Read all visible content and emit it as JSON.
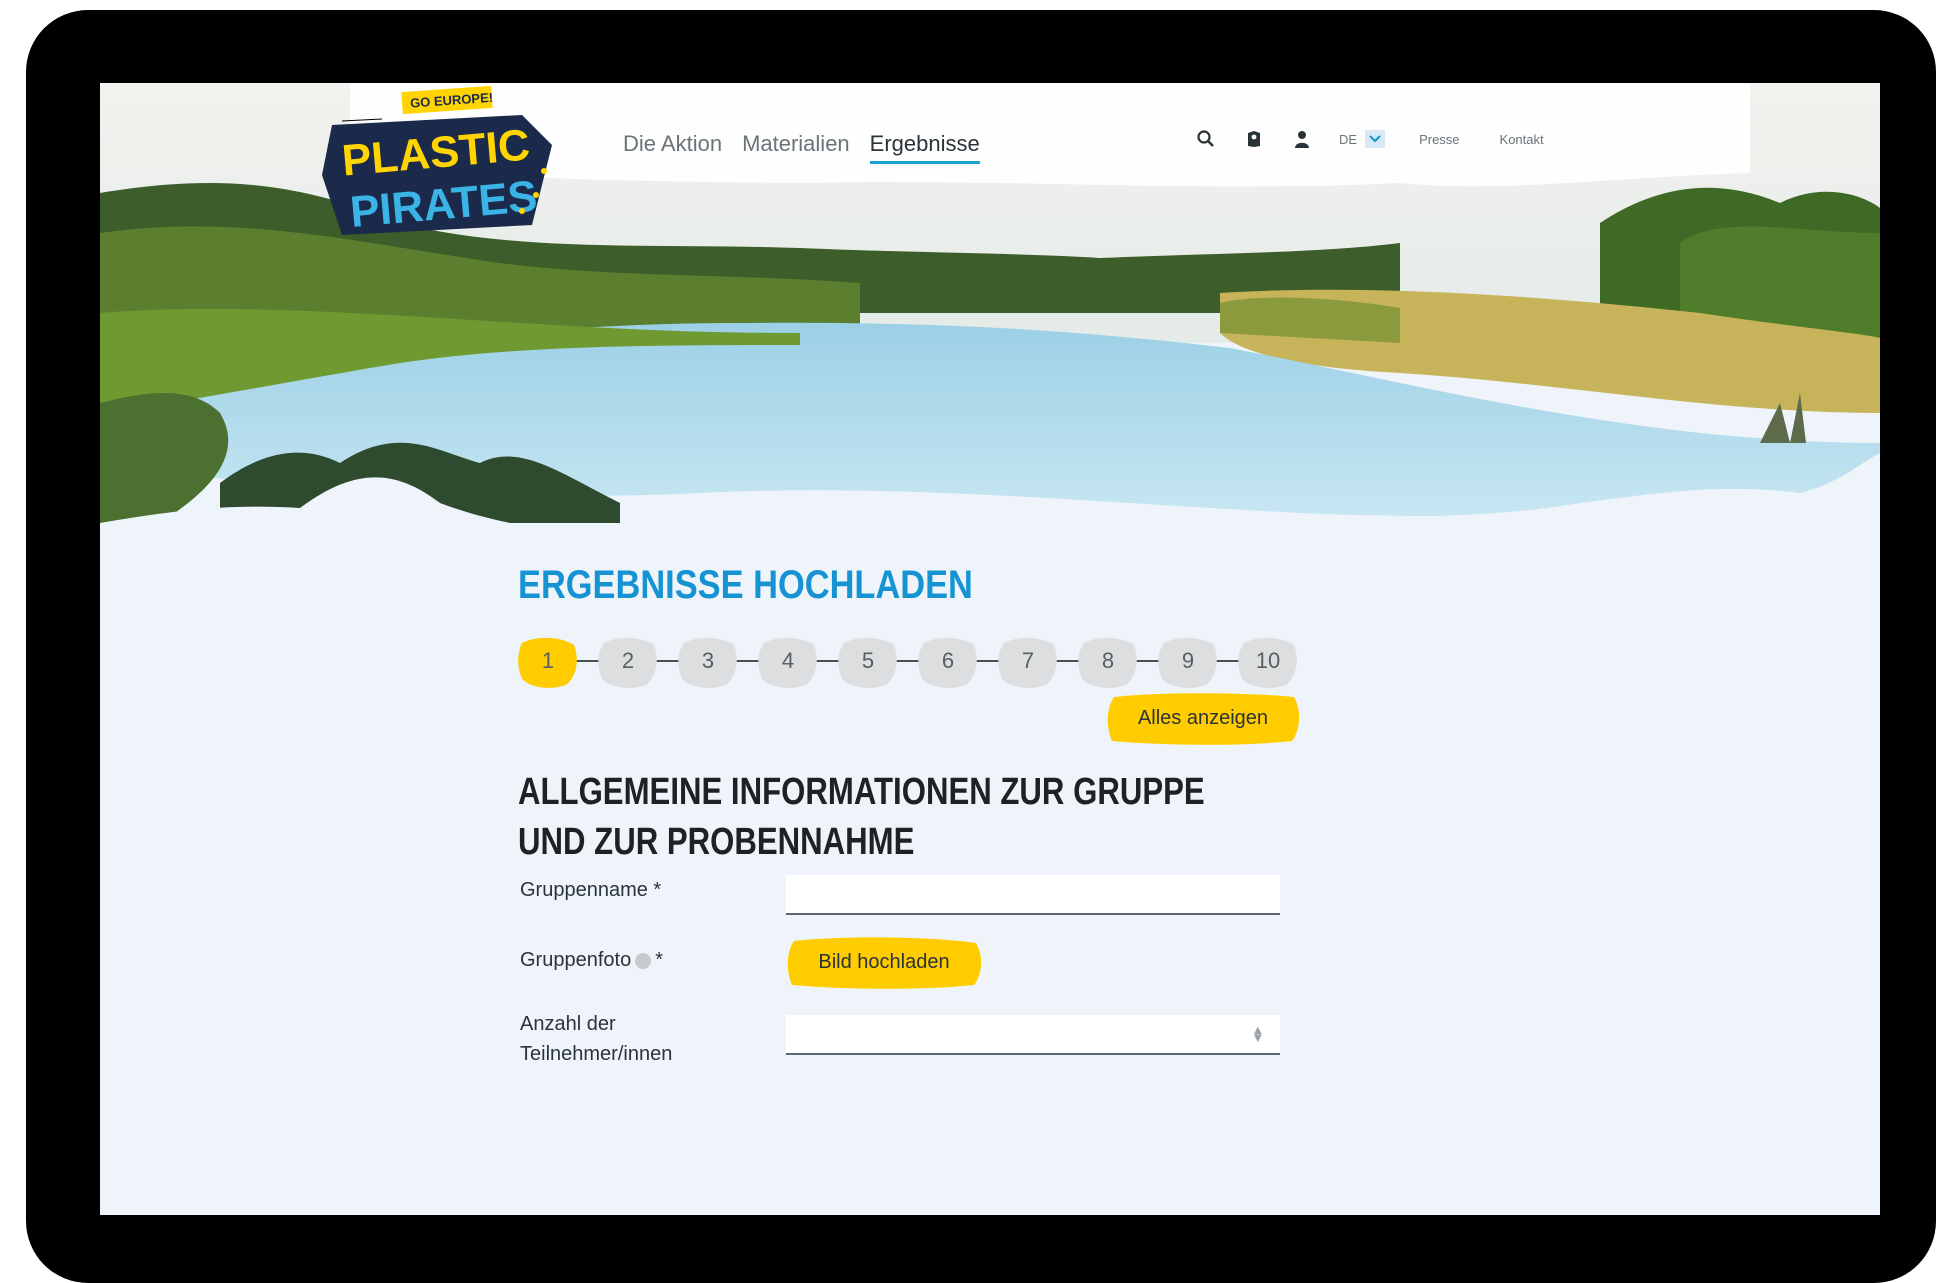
{
  "header": {
    "logo_text": [
      "GO EUROPE!",
      "PLASTIC",
      "PIRATES"
    ],
    "nav": [
      {
        "label": "Die Aktion",
        "active": false
      },
      {
        "label": "Materialien",
        "active": false
      },
      {
        "label": "Ergebnisse",
        "active": true
      }
    ],
    "icons": [
      "search-icon",
      "map-icon",
      "user-icon"
    ],
    "language": "DE",
    "links": [
      "Presse",
      "Kontakt"
    ]
  },
  "page": {
    "title": "ERGEBNISSE HOCHLADEN",
    "steps": [
      "1",
      "2",
      "3",
      "4",
      "5",
      "6",
      "7",
      "8",
      "9",
      "10"
    ],
    "current_step": "1",
    "show_all_label": "Alles anzeigen",
    "section_title": "ALLGEMEINE INFORMATIONEN ZUR GRUPPE UND ZUR PROBENNAHME"
  },
  "form": {
    "group_name": {
      "label": "Gruppenname *",
      "value": ""
    },
    "group_photo": {
      "label": "Gruppenfoto",
      "required_mark": "*",
      "button": "Bild hochladen"
    },
    "participants": {
      "label": "Anzahl der Teilnehmer/innen",
      "value": ""
    }
  },
  "colors": {
    "accent_blue": "#1593d2",
    "yellow": "#ffcc00",
    "dark": "#1d2225"
  }
}
